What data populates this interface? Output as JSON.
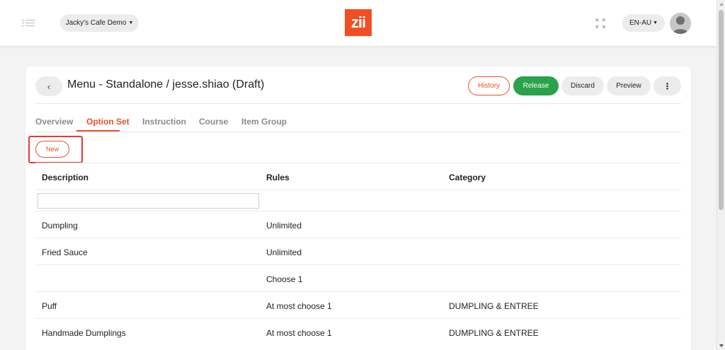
{
  "header": {
    "store_label": "Jacky's Cafe Demo",
    "logo_text": "zii",
    "language_label": "EN-AU",
    "brand_color": "#f04f23"
  },
  "page": {
    "back_icon": "chevron-left-icon",
    "title": "Menu - Standalone / jesse.shiao (Draft)",
    "buttons": {
      "history": "History",
      "release": "Release",
      "discard": "Discard",
      "preview": "Preview",
      "more": "⋮"
    }
  },
  "tabs": [
    {
      "label": "Overview",
      "active": false
    },
    {
      "label": "Option Set",
      "active": true
    },
    {
      "label": "Instruction",
      "active": false
    },
    {
      "label": "Course",
      "active": false
    },
    {
      "label": "Item Group",
      "active": false
    }
  ],
  "actions": {
    "new_label": "New"
  },
  "table": {
    "columns": [
      "Description",
      "Rules",
      "Category"
    ],
    "filter_value": "",
    "rows": [
      {
        "description": "Dumpling",
        "rules": "Unlimited",
        "category": ""
      },
      {
        "description": "Fried Sauce",
        "rules": "Unlimited",
        "category": ""
      },
      {
        "description": "",
        "rules": "Choose 1",
        "category": ""
      },
      {
        "description": "Puff",
        "rules": "At most choose 1",
        "category": "DUMPLING & ENTREE"
      },
      {
        "description": "Handmade Dumplings",
        "rules": "At most choose 1",
        "category": "DUMPLING & ENTREE"
      }
    ]
  },
  "colors": {
    "accent": "#e8512a",
    "release": "#2aa24a",
    "highlight": "#e53b33"
  }
}
